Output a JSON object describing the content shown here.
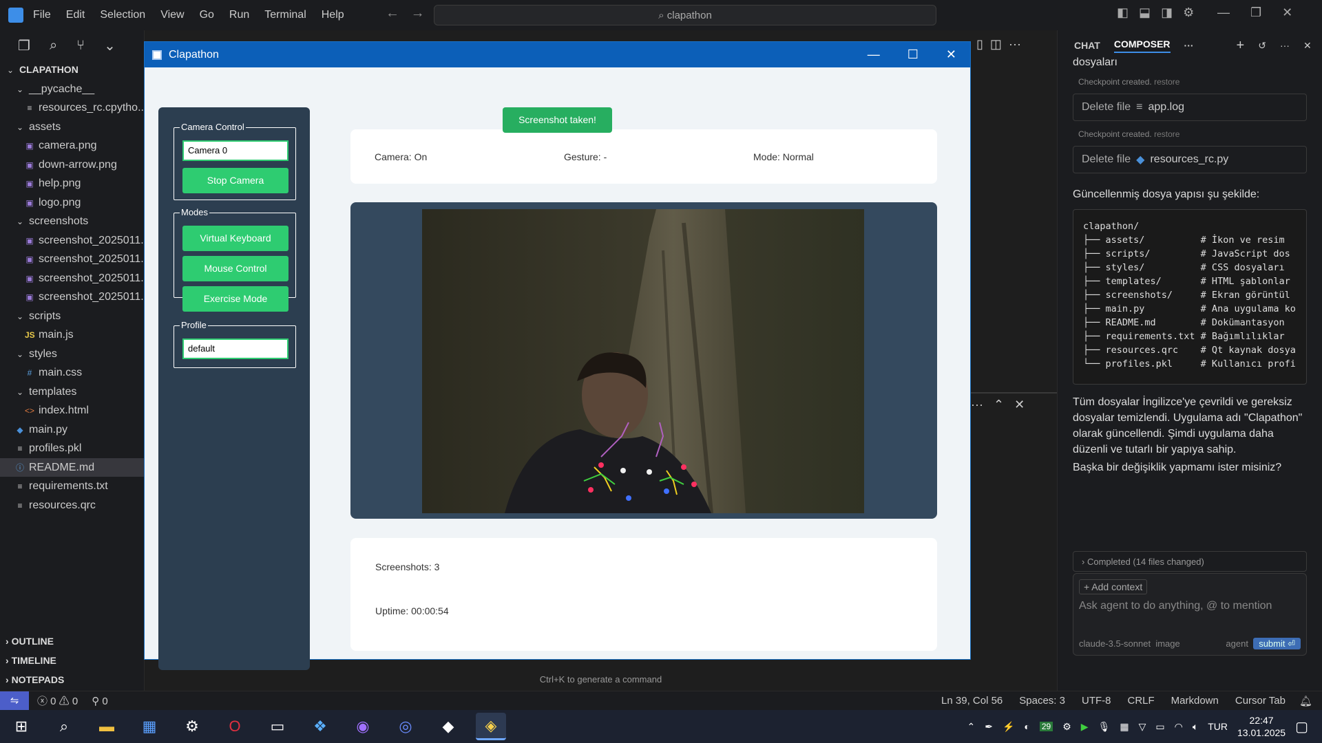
{
  "ide": {
    "menu": [
      "File",
      "Edit",
      "Selection",
      "View",
      "Go",
      "Run",
      "Terminal",
      "Help"
    ],
    "search": "clapathon",
    "explorer": {
      "root": "CLAPATHON",
      "items": [
        {
          "label": "__pycache__",
          "indent": 1,
          "icon": "chevron-down-icon",
          "glyph": "⌄"
        },
        {
          "label": "resources_rc.cpytho...",
          "indent": 2,
          "icon": "file-lines-icon",
          "glyph": "≡"
        },
        {
          "label": "assets",
          "indent": 1,
          "icon": "chevron-down-icon",
          "glyph": "⌄"
        },
        {
          "label": "camera.png",
          "indent": 2,
          "icon": "image-icon",
          "glyph": "▣"
        },
        {
          "label": "down-arrow.png",
          "indent": 2,
          "icon": "image-icon",
          "glyph": "▣"
        },
        {
          "label": "help.png",
          "indent": 2,
          "icon": "image-icon",
          "glyph": "▣"
        },
        {
          "label": "logo.png",
          "indent": 2,
          "icon": "image-icon",
          "glyph": "▣"
        },
        {
          "label": "screenshots",
          "indent": 1,
          "icon": "chevron-down-icon",
          "glyph": "⌄"
        },
        {
          "label": "screenshot_2025011...",
          "indent": 2,
          "icon": "image-icon",
          "glyph": "▣"
        },
        {
          "label": "screenshot_2025011...",
          "indent": 2,
          "icon": "image-icon",
          "glyph": "▣"
        },
        {
          "label": "screenshot_2025011...",
          "indent": 2,
          "icon": "image-icon",
          "glyph": "▣"
        },
        {
          "label": "screenshot_2025011...",
          "indent": 2,
          "icon": "image-icon",
          "glyph": "▣"
        },
        {
          "label": "scripts",
          "indent": 1,
          "icon": "chevron-down-icon",
          "glyph": "⌄"
        },
        {
          "label": "main.js",
          "indent": 2,
          "icon": "js-file-icon",
          "glyph": "JS"
        },
        {
          "label": "styles",
          "indent": 1,
          "icon": "chevron-down-icon",
          "glyph": "⌄"
        },
        {
          "label": "main.css",
          "indent": 2,
          "icon": "css-file-icon",
          "glyph": "#"
        },
        {
          "label": "templates",
          "indent": 1,
          "icon": "chevron-down-icon",
          "glyph": "⌄"
        },
        {
          "label": "index.html",
          "indent": 2,
          "icon": "html-file-icon",
          "glyph": "<>"
        },
        {
          "label": "main.py",
          "indent": 1,
          "icon": "python-file-icon",
          "glyph": "◆"
        },
        {
          "label": "profiles.pkl",
          "indent": 1,
          "icon": "file-lines-icon",
          "glyph": "≡"
        },
        {
          "label": "README.md",
          "indent": 1,
          "icon": "info-icon",
          "glyph": "ⓘ",
          "selected": true
        },
        {
          "label": "requirements.txt",
          "indent": 1,
          "icon": "file-lines-icon",
          "glyph": "≡"
        },
        {
          "label": "resources.qrc",
          "indent": 1,
          "icon": "file-lines-icon",
          "glyph": "≡"
        }
      ],
      "sections": [
        "OUTLINE",
        "TIMELINE",
        "NOTEPADS"
      ]
    },
    "cmd_hint": "Ctrl+K to generate a command",
    "status": {
      "errors": "0",
      "warnings": "0",
      "ports": "0",
      "right": [
        "Ln 39, Col 56",
        "Spaces: 3",
        "UTF-8",
        "CRLF",
        "Markdown",
        "Cursor Tab"
      ]
    }
  },
  "chat": {
    "tabs": [
      "CHAT",
      "COMPOSER"
    ],
    "top_text": "dosyaları",
    "checkpoint1": "Checkpoint created.",
    "checkpoint2": "Checkpoint created.",
    "restore": "restore",
    "delete1_label": "Delete file",
    "delete1_file": "app.log",
    "delete2_label": "Delete file",
    "delete2_file": "resources_rc.py",
    "structure_intro": "Güncellenmiş dosya yapısı şu şekilde:",
    "code": "clapathon/\n├── assets/          # İkon ve resim\n├── scripts/         # JavaScript dos\n├── styles/          # CSS dosyaları\n├── templates/       # HTML şablonlar\n├── screenshots/     # Ekran görüntül\n├── main.py          # Ana uygulama ko\n├── README.md        # Dokümantasyon\n├── requirements.txt # Bağımlılıklar\n├── resources.qrc    # Qt kaynak dosya\n└── profiles.pkl     # Kullanıcı profi",
    "summary": "Tüm dosyalar İngilizce'ye çevrildi ve gereksiz dosyalar temizlendi. Uygulama adı \"Clapathon\" olarak güncellendi. Şimdi uygulama daha düzenli ve tutarlı bir yapıya sahip.",
    "question": "Başka bir değişiklik yapmamı ister misiniz?",
    "completed": "Completed (14 files changed)",
    "add_context": "+ Add context",
    "placeholder": "Ask agent to do anything, @ to mention",
    "model": "claude-3.5-sonnet",
    "image": "image",
    "agent": "agent",
    "submit": "submit ⏎"
  },
  "app": {
    "title": "Clapathon",
    "camera_control_label": "Camera Control",
    "camera_select": "Camera 0",
    "stop_camera": "Stop Camera",
    "modes_label": "Modes",
    "virtual_keyboard": "Virtual Keyboard",
    "mouse_control": "Mouse Control",
    "exercise_mode": "Exercise Mode",
    "profile_label": "Profile",
    "profile_value": "default",
    "toast": "Screenshot taken!",
    "camera_status": "Camera: On",
    "gesture_status": "Gesture: -",
    "mode_status": "Mode: Normal",
    "screenshots": "Screenshots: 3",
    "uptime": "Uptime: 00:00:54",
    "colors": {
      "green": "#2ecc71",
      "dark": "#2c3e50",
      "frame": "#34495e",
      "titlebar": "#0c5fb8"
    }
  },
  "taskbar": {
    "time": "22:47",
    "date": "13.01.2025",
    "lang": "TUR",
    "badge": "29"
  }
}
